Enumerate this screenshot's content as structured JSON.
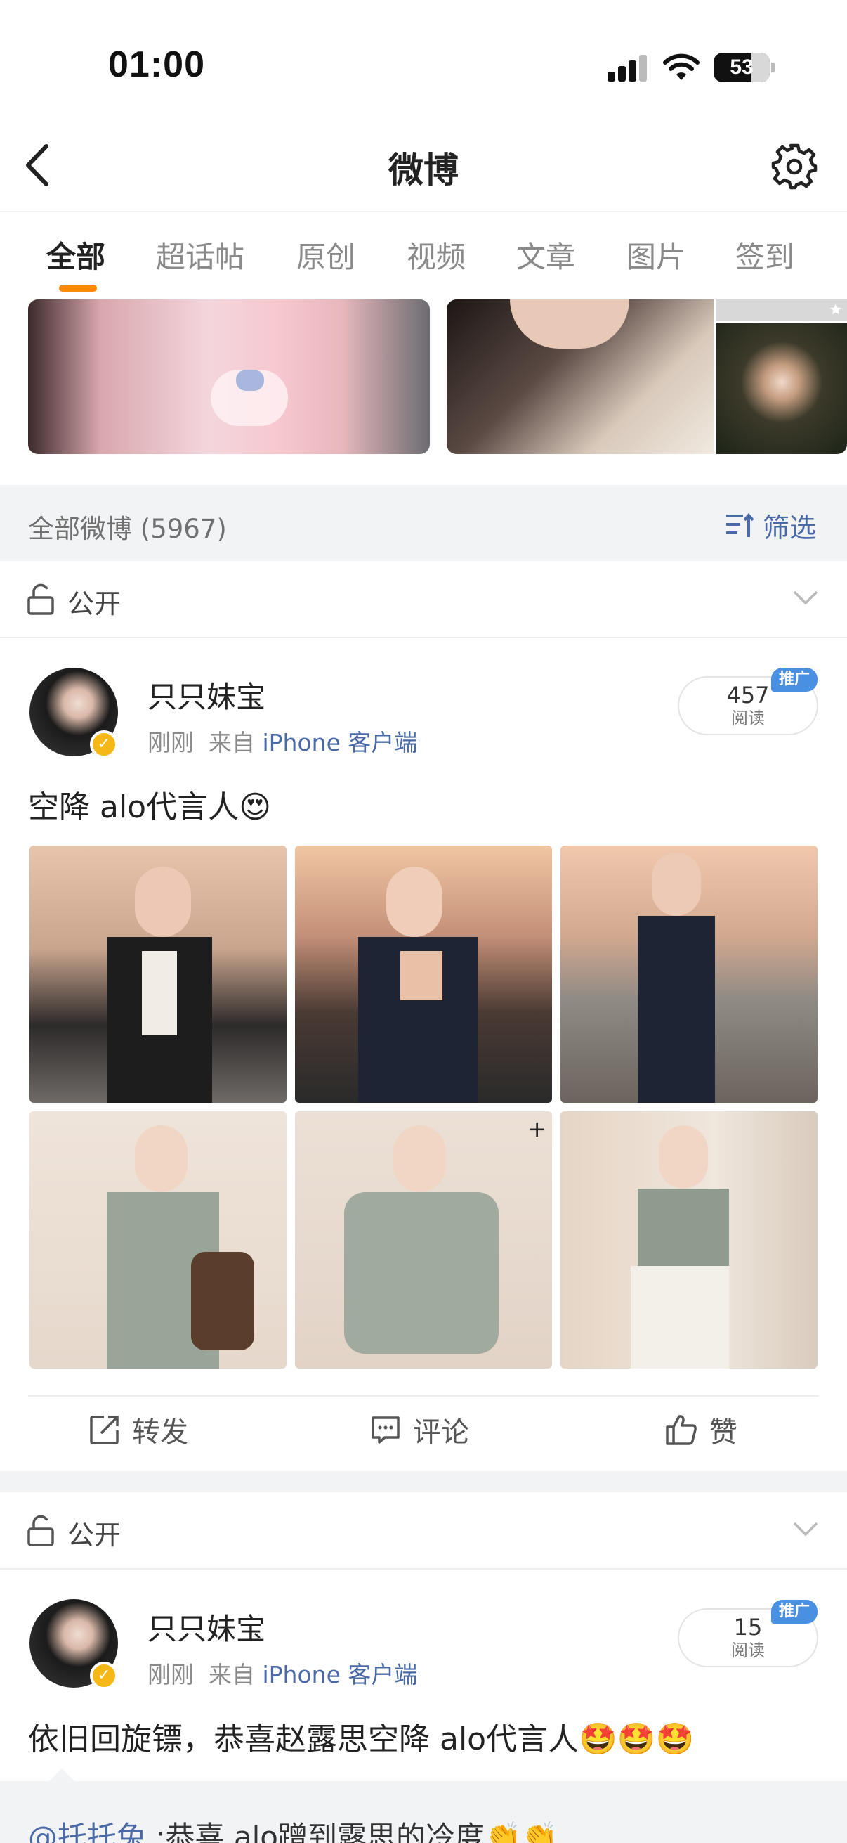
{
  "status_bar": {
    "time": "01:00",
    "battery": "53"
  },
  "header": {
    "title": "微博"
  },
  "tabs": [
    {
      "label": "全部"
    },
    {
      "label": "超话帖"
    },
    {
      "label": "原创"
    },
    {
      "label": "视频"
    },
    {
      "label": "文章"
    },
    {
      "label": "图片"
    },
    {
      "label": "签到"
    }
  ],
  "section": {
    "label": "全部微博 (5967)",
    "filter_label": "筛选"
  },
  "posts": [
    {
      "visibility": "公开",
      "username": "只只妹宝",
      "time": "刚刚",
      "source_prefix": "来自",
      "source": "iPhone 客户端",
      "reads": "457",
      "reads_label": "阅读",
      "promo": "推广",
      "text": "空降 alo代言人",
      "emoji": "😍",
      "image_count": 6
    },
    {
      "visibility": "公开",
      "username": "只只妹宝",
      "time": "刚刚",
      "source_prefix": "来自",
      "source": "iPhone 客户端",
      "reads": "15",
      "reads_label": "阅读",
      "promo": "推广",
      "text": "依旧回旋镖，恭喜赵露思空降 alo代言人",
      "emoji": "🤩🤩🤩"
    }
  ],
  "actions": {
    "repost": "转发",
    "comment": "评论",
    "like": "赞"
  },
  "repost_preview": {
    "user": "@托托兔",
    "text": ":恭喜 alo蹭到露思的冷度",
    "emoji": "👏👏"
  }
}
